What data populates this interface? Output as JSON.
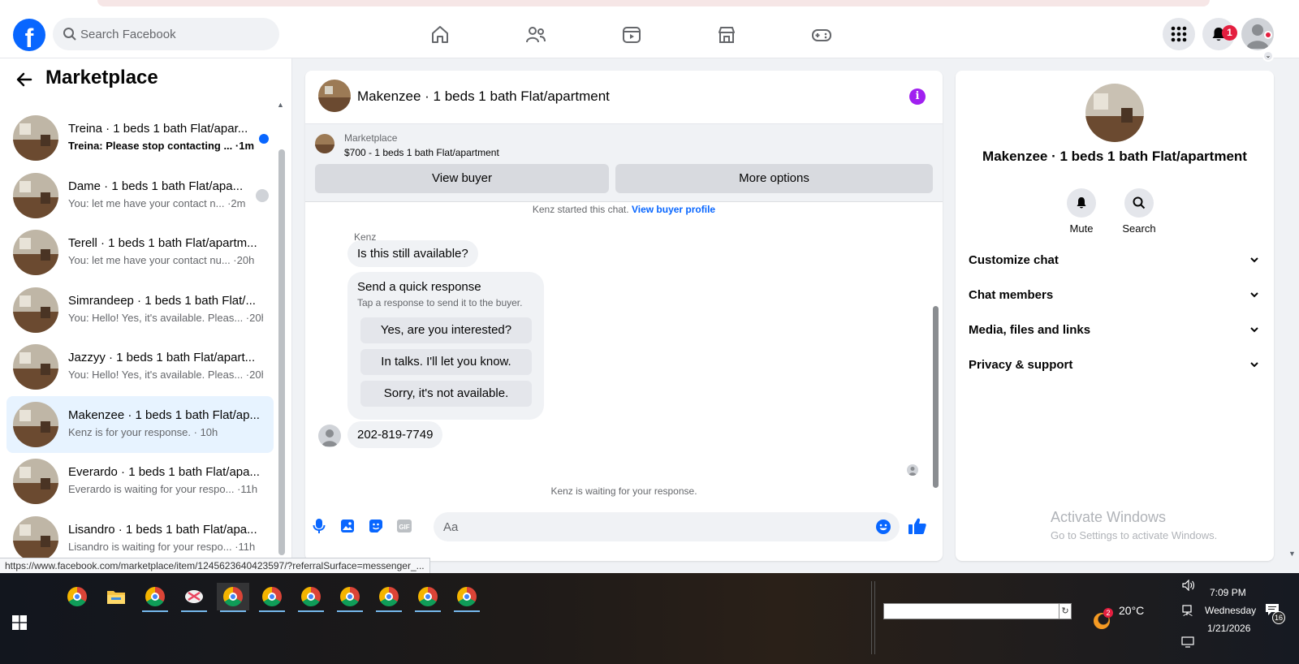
{
  "header": {
    "logo": "f",
    "search_placeholder": "Search Facebook",
    "nav_icons": [
      "home-icon",
      "friends-icon",
      "watch-icon",
      "marketplace-icon",
      "gaming-icon"
    ],
    "notifications_count": "1",
    "colors": {
      "brand": "#0866ff",
      "badge": "#e41e3f"
    }
  },
  "sidebar": {
    "title": "Marketplace",
    "conversations": [
      {
        "title": "Treina · 1 beds 1 bath Flat/apar...",
        "preview": "Treina: Please stop contacting ... ·1m",
        "unread": true
      },
      {
        "title": "Dame · 1 beds 1 bath Flat/apa...",
        "preview": "You: let me have your contact n... ·2m",
        "unread": false
      },
      {
        "title": "Terell · 1 beds 1 bath Flat/apartm...",
        "preview": "You: let me have your contact nu... ·20h",
        "unread": false
      },
      {
        "title": "Simrandeep · 1 beds 1 bath Flat/...",
        "preview": "You: Hello! Yes, it's available. Pleas... ·20h",
        "unread": false
      },
      {
        "title": "Jazzyy · 1 beds 1 bath Flat/apart...",
        "preview": "You: Hello! Yes, it's available. Pleas... ·20h",
        "unread": false
      },
      {
        "title": "Makenzee · 1 beds 1 bath Flat/ap...",
        "preview": "Kenz is for your response. · 10h",
        "unread": false,
        "active": true
      },
      {
        "title": "Everardo · 1 beds 1 bath Flat/apa...",
        "preview": "Everardo is waiting for your respo... ·11h",
        "unread": false
      },
      {
        "title": "Lisandro · 1 beds 1 bath Flat/apa...",
        "preview": "Lisandro is waiting for your respo... ·11h",
        "unread": false
      }
    ]
  },
  "chat": {
    "title": "Makenzee · 1 beds 1 bath Flat/apartment",
    "info_icon": "i",
    "listing": {
      "source": "Marketplace",
      "price_line": "$700 - 1 beds 1 bath Flat/apartment",
      "view_buyer": "View buyer",
      "more_options": "More options"
    },
    "started_text": "Kenz started this chat.",
    "view_buyer_profile": "View buyer profile",
    "sender": "Kenz",
    "message_1": "Is this still available?",
    "quick": {
      "title": "Send a quick response",
      "subtitle": "Tap a response to send it to the buyer.",
      "options": [
        "Yes, are you interested?",
        "In talks. I'll let you know.",
        "Sorry, it's not available."
      ]
    },
    "message_2": "202-819-7749",
    "waiting": "Kenz is waiting for your response.",
    "composer_placeholder": "Aa",
    "composer_icons": [
      "microphone-icon",
      "image-icon",
      "sticker-icon",
      "gif-icon",
      "emoji-icon",
      "like-icon"
    ]
  },
  "info_panel": {
    "name": "Makenzee · 1 beds 1 bath Flat/apartment",
    "mute": "Mute",
    "search": "Search",
    "sections": [
      "Customize chat",
      "Chat members",
      "Media, files and links",
      "Privacy & support"
    ],
    "watermark_title": "Activate Windows",
    "watermark_sub": "Go to Settings to activate Windows."
  },
  "status_url": "https://www.facebook.com/marketplace/item/1245623640423597/?referralSurface=messenger_...",
  "taskbar": {
    "apps": [
      "chrome",
      "file-explorer",
      "chrome-profile-m",
      "snipping-tool",
      "chrome-profile-2",
      "chrome-profile-3",
      "chrome-profile-4",
      "chrome-profile-5",
      "chrome-profile-6",
      "chrome-profile-7",
      "chrome-profile-8"
    ],
    "weather_badge": "2",
    "temperature": "20°C",
    "time": "7:09 PM",
    "day": "Wednesday",
    "date": "1/21/2026",
    "notification_count": "16"
  }
}
